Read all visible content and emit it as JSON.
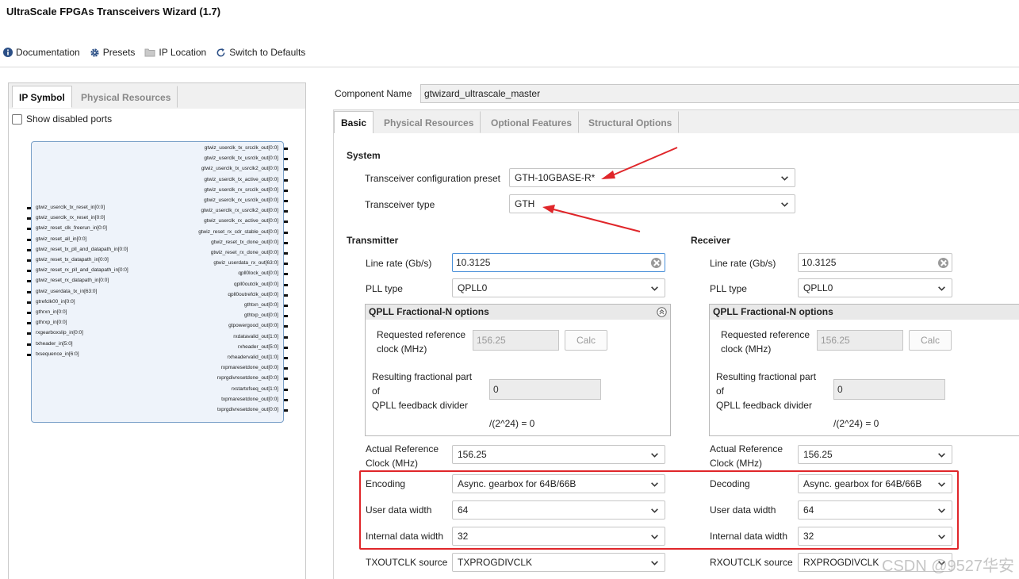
{
  "window": {
    "title": "UltraScale FPGAs Transceivers Wizard (1.7)"
  },
  "toolbar": {
    "documentation": "Documentation",
    "presets": "Presets",
    "ip_location": "IP Location",
    "switch_defaults": "Switch to Defaults"
  },
  "left_panel": {
    "tabs": [
      "IP Symbol",
      "Physical Resources"
    ],
    "show_disabled_ports": "Show disabled ports",
    "left_ports": [
      "gtwiz_userclk_tx_reset_in[0:0]",
      "gtwiz_userclk_rx_reset_in[0:0]",
      "gtwiz_reset_clk_freerun_in[0:0]",
      "gtwiz_reset_all_in[0:0]",
      "gtwiz_reset_tx_pll_and_datapath_in[0:0]",
      "gtwiz_reset_tx_datapath_in[0:0]",
      "gtwiz_reset_rx_pll_and_datapath_in[0:0]",
      "gtwiz_reset_rx_datapath_in[0:0]",
      "gtwiz_userdata_tx_in[63:0]",
      "gtrefclk00_in[0:0]",
      "gthrxn_in[0:0]",
      "gthrxp_in[0:0]",
      "rxgearboxslip_in[0:0]",
      "txheader_in[5:0]",
      "txsequence_in[6:0]"
    ],
    "right_ports": [
      "gtwiz_userclk_tx_srcclk_out[0:0]",
      "gtwiz_userclk_tx_usrclk_out[0:0]",
      "gtwiz_userclk_tx_usrclk2_out[0:0]",
      "gtwiz_userclk_tx_active_out[0:0]",
      "gtwiz_userclk_rx_srcclk_out[0:0]",
      "gtwiz_userclk_rx_usrclk_out[0:0]",
      "gtwiz_userclk_rx_usrclk2_out[0:0]",
      "gtwiz_userclk_rx_active_out[0:0]",
      "gtwiz_reset_rx_cdr_stable_out[0:0]",
      "gtwiz_reset_tx_done_out[0:0]",
      "gtwiz_reset_rx_done_out[0:0]",
      "gtwiz_userdata_rx_out[63:0]",
      "qpll0lock_out[0:0]",
      "qpll0outclk_out[0:0]",
      "qpll0outrefclk_out[0:0]",
      "gthtxn_out[0:0]",
      "gthtxp_out[0:0]",
      "gtpowergood_out[0:0]",
      "rxdatavalid_out[1:0]",
      "rxheader_out[5:0]",
      "rxheadervalid_out[1:0]",
      "rxpmaresetdone_out[0:0]",
      "rxprgdivresetdone_out[0:0]",
      "rxstartofseq_out[1:0]",
      "txpmaresetdone_out[0:0]",
      "txprgdivresetdone_out[0:0]"
    ]
  },
  "component": {
    "label": "Component Name",
    "value": "gtwizard_ultrascale_master"
  },
  "right_tabs": [
    "Basic",
    "Physical Resources",
    "Optional Features",
    "Structural Options"
  ],
  "system": {
    "heading": "System",
    "preset_label": "Transceiver configuration preset",
    "preset_value": "GTH-10GBASE-R*",
    "type_label": "Transceiver type",
    "type_value": "GTH"
  },
  "transmitter": {
    "heading": "Transmitter",
    "line_rate_label": "Line rate (Gb/s)",
    "line_rate_value": "10.3125",
    "pll_label": "PLL type",
    "pll_value": "QPLL0",
    "frac_heading": "QPLL Fractional-N options",
    "req_ref_label1": "Requested reference",
    "req_ref_label2": "clock (MHz)",
    "req_ref_value": "156.25",
    "calc": "Calc",
    "frac_label1": "Resulting fractional part",
    "frac_label2": "of",
    "frac_label3": "QPLL feedback divider",
    "frac_value": "0",
    "frac_formula": "/(2^24) = 0",
    "actual_ref_label1": "Actual Reference",
    "actual_ref_label2": "Clock (MHz)",
    "actual_ref_value": "156.25",
    "encoding_label": "Encoding",
    "encoding_value": "Async. gearbox for 64B/66B",
    "user_width_label": "User data width",
    "user_width_value": "64",
    "internal_width_label": "Internal data width",
    "internal_width_value": "32",
    "outclk_label": "TXOUTCLK source",
    "outclk_value": "TXPROGDIVCLK"
  },
  "receiver": {
    "heading": "Receiver",
    "line_rate_label": "Line rate (Gb/s)",
    "line_rate_value": "10.3125",
    "pll_label": "PLL type",
    "pll_value": "QPLL0",
    "frac_heading": "QPLL Fractional-N options",
    "req_ref_label1": "Requested reference",
    "req_ref_label2": "clock (MHz)",
    "req_ref_value": "156.25",
    "calc": "Calc",
    "frac_label1": "Resulting fractional part",
    "frac_label2": "of",
    "frac_label3": "QPLL feedback divider",
    "frac_value": "0",
    "frac_formula": "/(2^24) = 0",
    "actual_ref_label1": "Actual Reference",
    "actual_ref_label2": "Clock (MHz)",
    "actual_ref_value": "156.25",
    "decoding_label": "Decoding",
    "decoding_value": "Async. gearbox for 64B/66B",
    "user_width_label": "User data width",
    "user_width_value": "64",
    "internal_width_label": "Internal data width",
    "internal_width_value": "32",
    "outclk_label": "RXOUTCLK source",
    "outclk_value": "RXPROGDIVCLK"
  },
  "watermark": "CSDN @9527华安",
  "colors": {
    "annotation_red": "#e0262a",
    "focus_blue": "#4a90d9",
    "symbol_fill": "#eef3fa"
  }
}
